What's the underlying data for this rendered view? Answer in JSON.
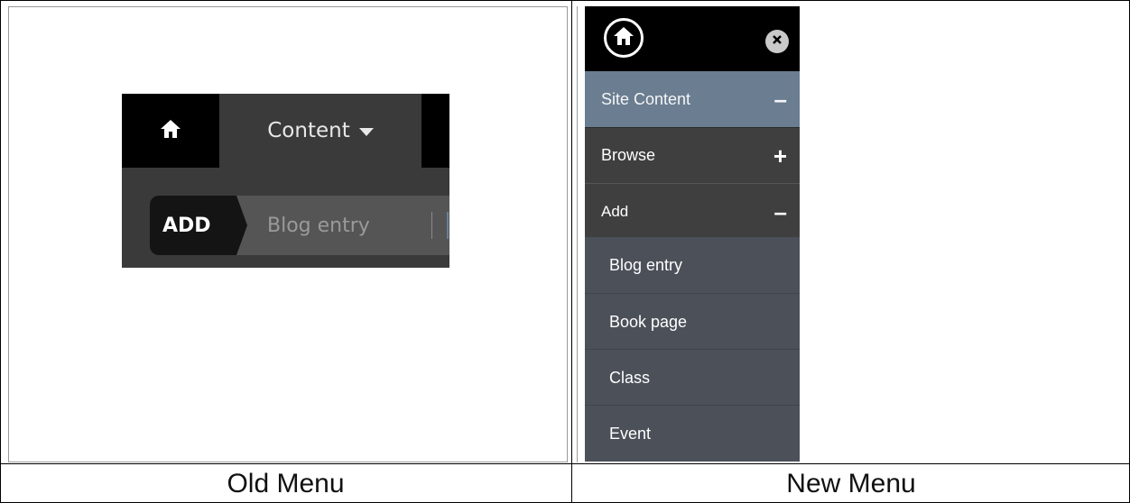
{
  "old_menu": {
    "content_tab_label": "Content",
    "add_label": "ADD",
    "blog_entry_link": "Blog entry",
    "colors": {
      "toolbar_bg": "#000000",
      "tab_bg": "#3a3a3a",
      "add_bg": "#141414",
      "bar_bg": "#555555"
    }
  },
  "new_menu": {
    "site_content": {
      "label": "Site Content",
      "toggle": "–"
    },
    "browse": {
      "label": "Browse",
      "toggle": "+"
    },
    "add": {
      "label": "Add",
      "toggle": "–"
    },
    "add_items": [
      {
        "label": "Blog entry"
      },
      {
        "label": "Book page"
      },
      {
        "label": "Class"
      },
      {
        "label": "Event"
      }
    ],
    "colors": {
      "header_bg": "#000000",
      "section_bg": "#6b7d90",
      "row_bg": "#3f3f3f",
      "sub_bg": "#4b5059"
    },
    "icons": {
      "home": "home-icon",
      "close": "close-icon"
    }
  },
  "captions": {
    "old": "Old Menu",
    "new": "New Menu"
  }
}
